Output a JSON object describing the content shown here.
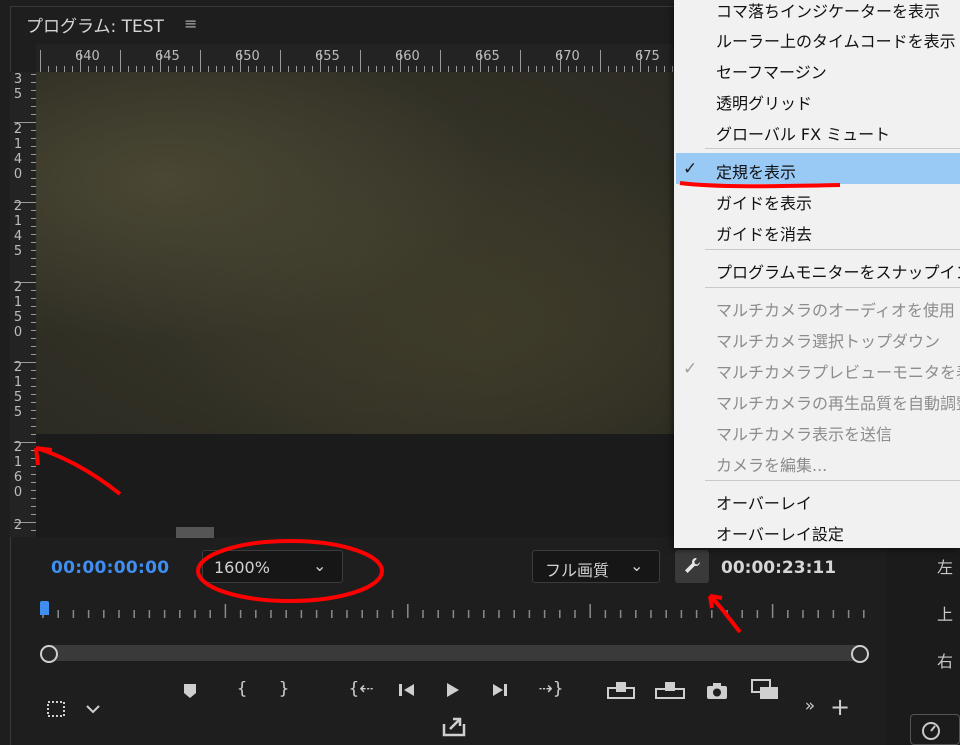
{
  "panel": {
    "title": "プログラム: TEST",
    "menu_glyph": "≡",
    "ruler_top_labels": [
      "640",
      "645",
      "650",
      "655",
      "660",
      "665",
      "670",
      "675"
    ],
    "ruler_left_labels": [
      "3\n5",
      "2\n1\n4\n0",
      "2\n1\n4\n5",
      "2\n1\n5\n0",
      "2\n1\n5\n5",
      "2\n1\n6\n0",
      "2"
    ]
  },
  "controls": {
    "timecode_current": "00:00:00:00",
    "zoom_value": "1600%",
    "quality_value": "フル画質",
    "timecode_duration": "00:00:23:11",
    "icons": {
      "wrench": "wrench-icon",
      "marker": "marker-icon",
      "in": "mark-in-icon",
      "out": "mark-out-icon",
      "go_in": "go-to-in-icon",
      "step_back": "step-back-icon",
      "play": "play-icon",
      "step_fwd": "step-forward-icon",
      "go_out": "go-to-out-icon",
      "lift": "lift-icon",
      "extract": "extract-icon",
      "camera": "export-frame-icon",
      "compare": "comparison-view-icon",
      "safe": "safe-margins-icon",
      "more": "more-icon",
      "add": "add-button-icon",
      "export": "export-icon"
    }
  },
  "menu": {
    "items": [
      {
        "label": "コマ落ちインジケーターを表示",
        "enabled": true,
        "checked": false
      },
      {
        "label": "ルーラー上のタイムコードを表示",
        "enabled": true,
        "checked": false
      },
      {
        "label": "セーフマージン",
        "enabled": true,
        "checked": false
      },
      {
        "label": "透明グリッド",
        "enabled": true,
        "checked": false
      },
      {
        "label": "グローバル FX ミュート",
        "enabled": true,
        "checked": false
      },
      {
        "label": "定規を表示",
        "enabled": true,
        "checked": true,
        "highlighted": true
      },
      {
        "label": "ガイドを表示",
        "enabled": true,
        "checked": false
      },
      {
        "label": "ガイドを消去",
        "enabled": true,
        "checked": false
      },
      {
        "label": "プログラムモニターをスナップイン",
        "enabled": true,
        "checked": false
      },
      {
        "label": "マルチカメラのオーディオを使用",
        "enabled": false,
        "checked": false
      },
      {
        "label": "マルチカメラ選択トップダウン",
        "enabled": false,
        "checked": false
      },
      {
        "label": "マルチカメラプレビューモニタを表示",
        "enabled": false,
        "checked": true
      },
      {
        "label": "マルチカメラの再生品質を自動調整",
        "enabled": false,
        "checked": false
      },
      {
        "label": "マルチカメラ表示を送信",
        "enabled": false,
        "checked": false
      },
      {
        "label": "カメラを編集...",
        "enabled": false,
        "checked": false
      },
      {
        "label": "オーバーレイ",
        "enabled": true,
        "checked": false
      },
      {
        "label": "オーバーレイ設定",
        "enabled": true,
        "checked": false
      }
    ]
  },
  "right_panel": {
    "labels": [
      "左",
      "上",
      "右"
    ]
  },
  "colors": {
    "accent_blue": "#3f8ef0",
    "menu_highlight": "#99c9f5",
    "annotation_red": "#ff0000"
  }
}
